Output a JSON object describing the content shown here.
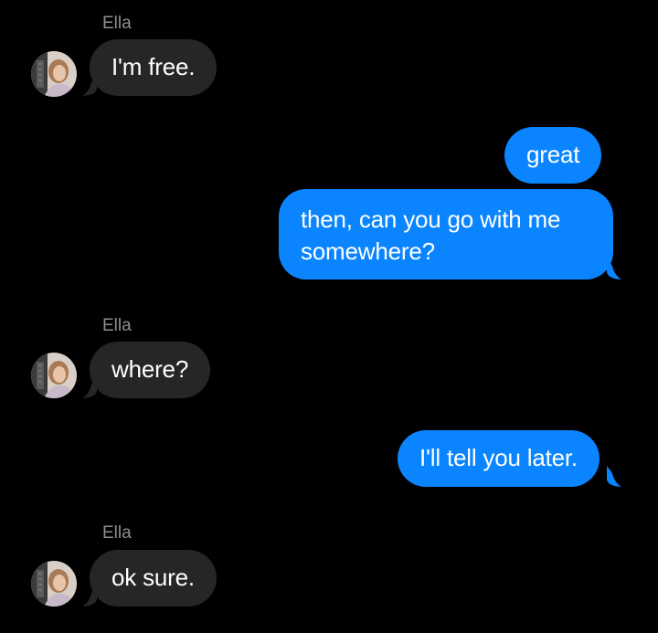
{
  "colors": {
    "background": "#000000",
    "incoming_bubble": "#262629",
    "outgoing_bubble": "#0a84ff",
    "sender_name": "#8e8e93",
    "text": "#ffffff"
  },
  "conversation": {
    "contact_name": "Ella",
    "messages": [
      {
        "direction": "incoming",
        "sender": "Ella",
        "text": "I'm free."
      },
      {
        "direction": "outgoing",
        "text": "great"
      },
      {
        "direction": "outgoing",
        "text": "then, can you go with me somewhere?"
      },
      {
        "direction": "incoming",
        "sender": "Ella",
        "text": "where?"
      },
      {
        "direction": "outgoing",
        "text": "I'll tell you later."
      },
      {
        "direction": "incoming",
        "sender": "Ella",
        "text": "ok sure."
      }
    ]
  }
}
